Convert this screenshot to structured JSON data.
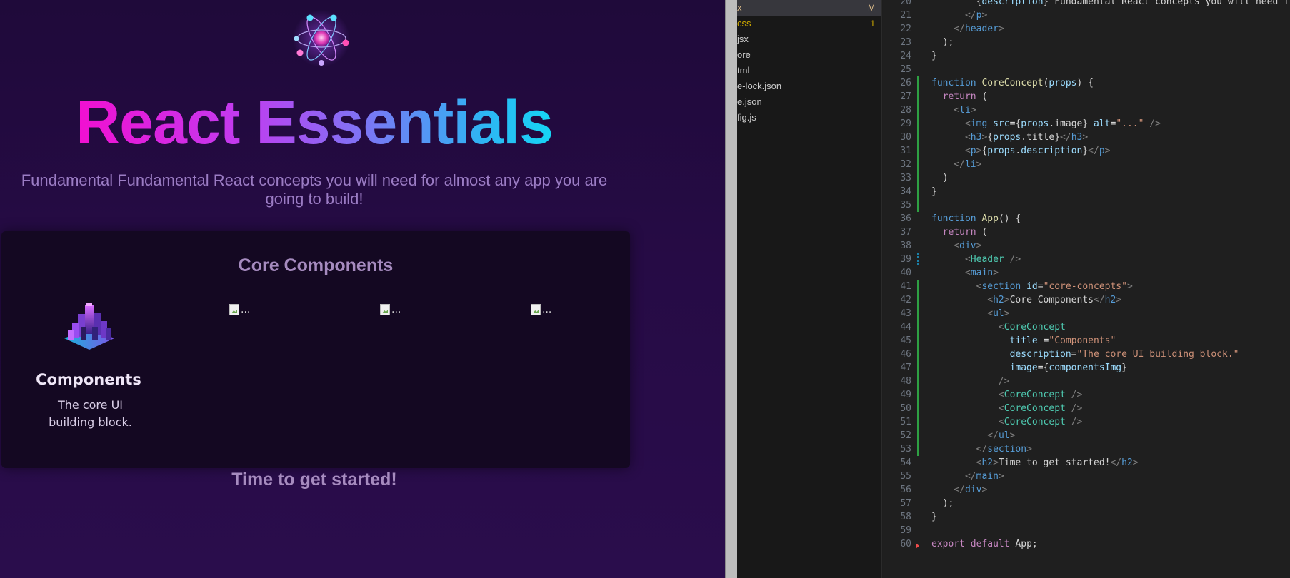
{
  "app": {
    "title": "React Essentials",
    "tagline": "Fundamental Fundamental React concepts you will need for almost any app you are going to build!",
    "section_heading": "Core Components",
    "concepts": [
      {
        "title": "Components",
        "description": "The core UI building block.",
        "image": "components-image"
      }
    ],
    "broken_images": [
      {
        "alt": "..."
      },
      {
        "alt": "..."
      },
      {
        "alt": "..."
      }
    ],
    "footer_heading": "Time to get started!"
  },
  "explorer": {
    "items": [
      {
        "name": "x",
        "badge": "M",
        "color": "#e2c08d"
      },
      {
        "name": "css",
        "badge": "1",
        "color": "#cca700"
      },
      {
        "name": "jsx",
        "badge": "",
        "color": "#cccccc"
      },
      {
        "name": "ore",
        "badge": "",
        "color": "#cccccc"
      },
      {
        "name": "tml",
        "badge": "",
        "color": "#cccccc"
      },
      {
        "name": "e-lock.json",
        "badge": "",
        "color": "#cccccc"
      },
      {
        "name": "e.json",
        "badge": "",
        "color": "#cccccc"
      },
      {
        "name": "fig.js",
        "badge": "",
        "color": "#cccccc"
      }
    ]
  },
  "editor": {
    "lines": [
      {
        "n": "20",
        "code": "        {description} Fundamental React concepts you will need f"
      },
      {
        "n": "21",
        "code": "      </p>"
      },
      {
        "n": "22",
        "code": "    </header>"
      },
      {
        "n": "23",
        "code": "  );"
      },
      {
        "n": "24",
        "code": "}"
      },
      {
        "n": "25",
        "code": ""
      },
      {
        "n": "26",
        "code": "function CoreConcept(props) {"
      },
      {
        "n": "27",
        "code": "  return ("
      },
      {
        "n": "28",
        "code": "    <li>"
      },
      {
        "n": "29",
        "code": "      <img src={props.image} alt=\"...\" />"
      },
      {
        "n": "30",
        "code": "      <h3>{props.title}</h3>"
      },
      {
        "n": "31",
        "code": "      <p>{props.description}</p>"
      },
      {
        "n": "32",
        "code": "    </li>"
      },
      {
        "n": "33",
        "code": "  )"
      },
      {
        "n": "34",
        "code": "}"
      },
      {
        "n": "35",
        "code": ""
      },
      {
        "n": "36",
        "code": "function App() {"
      },
      {
        "n": "37",
        "code": "  return ("
      },
      {
        "n": "38",
        "code": "    <div>"
      },
      {
        "n": "39",
        "code": "      <Header />"
      },
      {
        "n": "40",
        "code": "      <main>"
      },
      {
        "n": "41",
        "code": "        <section id=\"core-concepts\">"
      },
      {
        "n": "42",
        "code": "          <h2>Core Components</h2>"
      },
      {
        "n": "43",
        "code": "          <ul>"
      },
      {
        "n": "44",
        "code": "            <CoreConcept"
      },
      {
        "n": "45",
        "code": "              title =\"Components\""
      },
      {
        "n": "46",
        "code": "              description=\"The core UI building block.\""
      },
      {
        "n": "47",
        "code": "              image={componentsImg}"
      },
      {
        "n": "48",
        "code": "            />"
      },
      {
        "n": "49",
        "code": "            <CoreConcept />"
      },
      {
        "n": "50",
        "code": "            <CoreConcept />"
      },
      {
        "n": "51",
        "code": "            <CoreConcept />"
      },
      {
        "n": "52",
        "code": "          </ul>"
      },
      {
        "n": "53",
        "code": "        </section>"
      },
      {
        "n": "54",
        "code": "        <h2>Time to get started!</h2>"
      },
      {
        "n": "55",
        "code": "      </main>"
      },
      {
        "n": "56",
        "code": "    </div>"
      },
      {
        "n": "57",
        "code": "  );"
      },
      {
        "n": "58",
        "code": "}"
      },
      {
        "n": "59",
        "code": ""
      },
      {
        "n": "60",
        "code": "export default App;"
      }
    ]
  }
}
